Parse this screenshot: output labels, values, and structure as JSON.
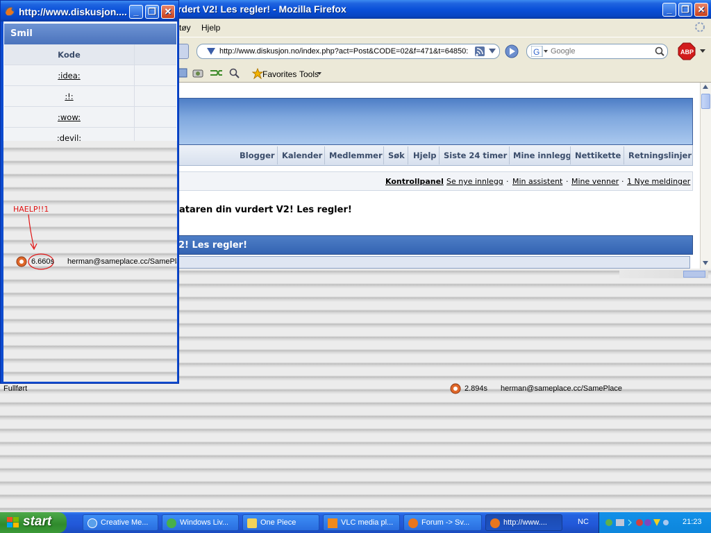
{
  "browser": {
    "title_visible": "rdert V2! Les regler! - Mozilla Firefox",
    "menu": {
      "partial_item": "tøy",
      "help": "Hjelp"
    },
    "url": "http://www.diskusjon.no/index.php?act=Post&CODE=02&f=471&t=64850:",
    "search_placeholder": "Google",
    "bookmarks": {
      "favorites": "Favorites",
      "tools": "Tools"
    }
  },
  "forum": {
    "nav": [
      "Blogger",
      "Kalender",
      "Medlemmer",
      "Søk",
      "Hjelp",
      "Siste 24 timer",
      "Mine innlegg",
      "Nettikette",
      "Retningslinjer"
    ],
    "user_links": {
      "control_panel": "Kontrollpanel",
      "new_posts": "Se nye innlegg",
      "assistant": "Min assistent",
      "friends": "Mine venner",
      "messages": "1 Nye meldinger"
    },
    "notice": "ataren din vurdert V2! Les regler!",
    "post_header": "2! Les regler!"
  },
  "status": {
    "text": "Fullført",
    "time": "2.894s",
    "user": "herman@sameplace.cc/SamePlace"
  },
  "popup": {
    "title": "http://www.diskusjon....",
    "section": "Smil",
    "column": "Kode",
    "codes": [
      ":idea:",
      ":!:",
      ":wow:",
      ":devil:"
    ],
    "annotation": "HAELP!!1",
    "status_time": "6.660s",
    "status_user": "herman@sameplace.cc/SamePlac"
  },
  "taskbar": {
    "start": "start",
    "tasks": [
      "Creative Me...",
      "Windows Liv...",
      "One Piece",
      "VLC media pl...",
      "Forum -> Sv...",
      "http://www...."
    ],
    "lang": "NC",
    "clock": "21:23"
  }
}
